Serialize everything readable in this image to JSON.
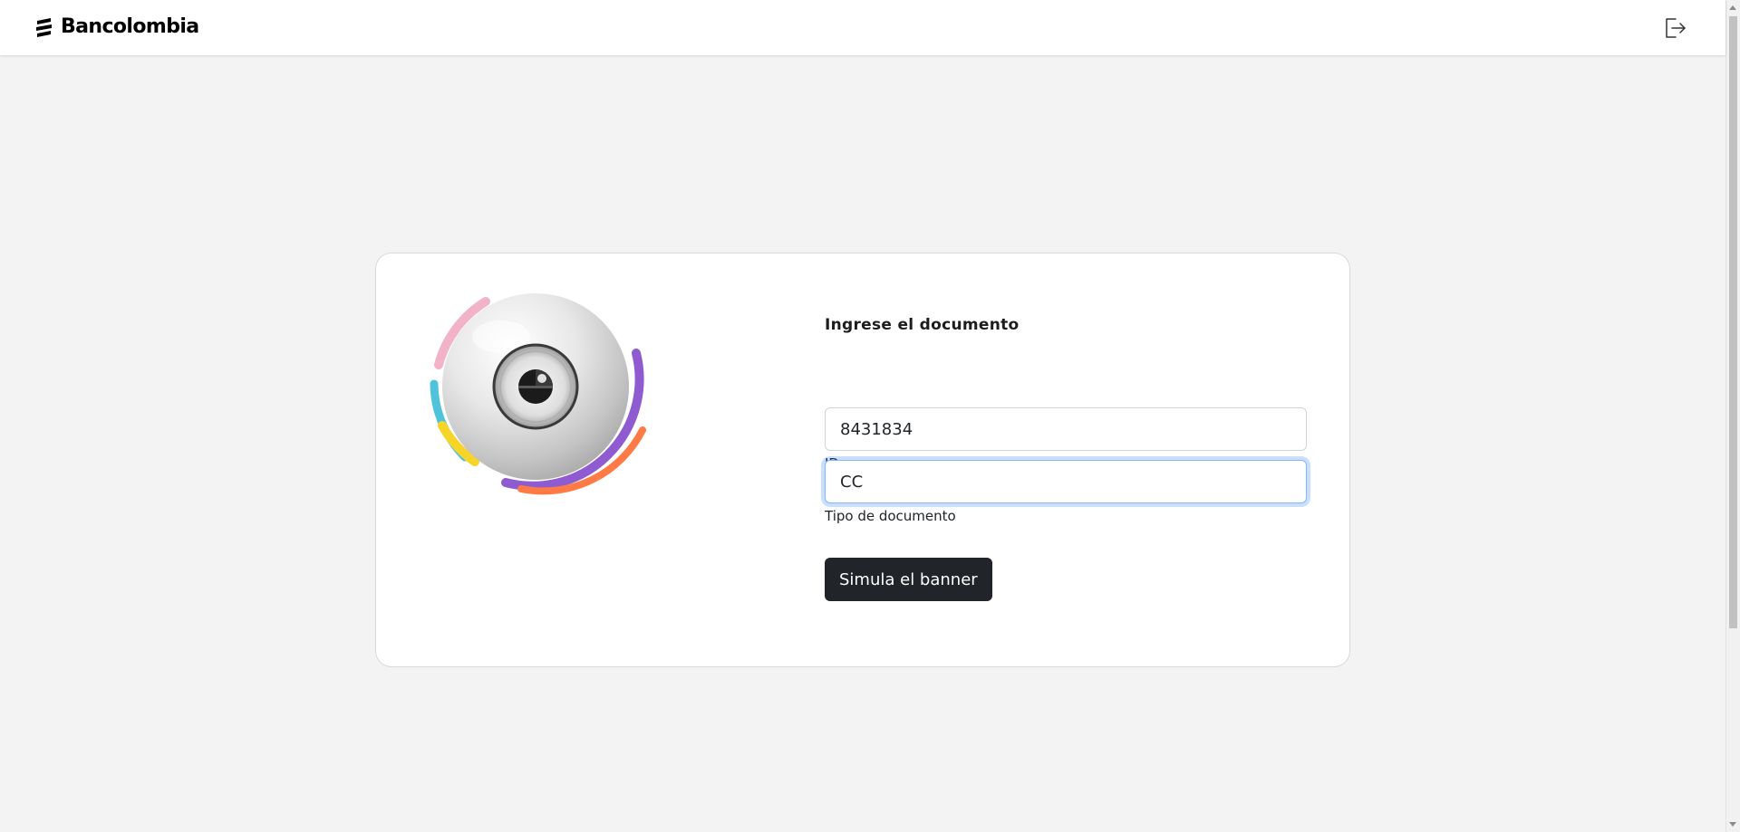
{
  "header": {
    "brand_name": "Bancolombia",
    "logout_icon": "logout-icon"
  },
  "hero": {
    "icon": "camera-eye-illustration",
    "colors": {
      "pink": "#f2b2c8",
      "cyan": "#4fc3dc",
      "yellow": "#f7d428",
      "purple": "#8e5bd0",
      "orange": "#ff7a45"
    }
  },
  "form": {
    "title": "Ingrese el documento",
    "id_field": {
      "value": "8431834",
      "label": "ID"
    },
    "doc_type_field": {
      "value": "CC",
      "label": "Tipo de documento"
    },
    "submit_label": "Simula el banner"
  }
}
